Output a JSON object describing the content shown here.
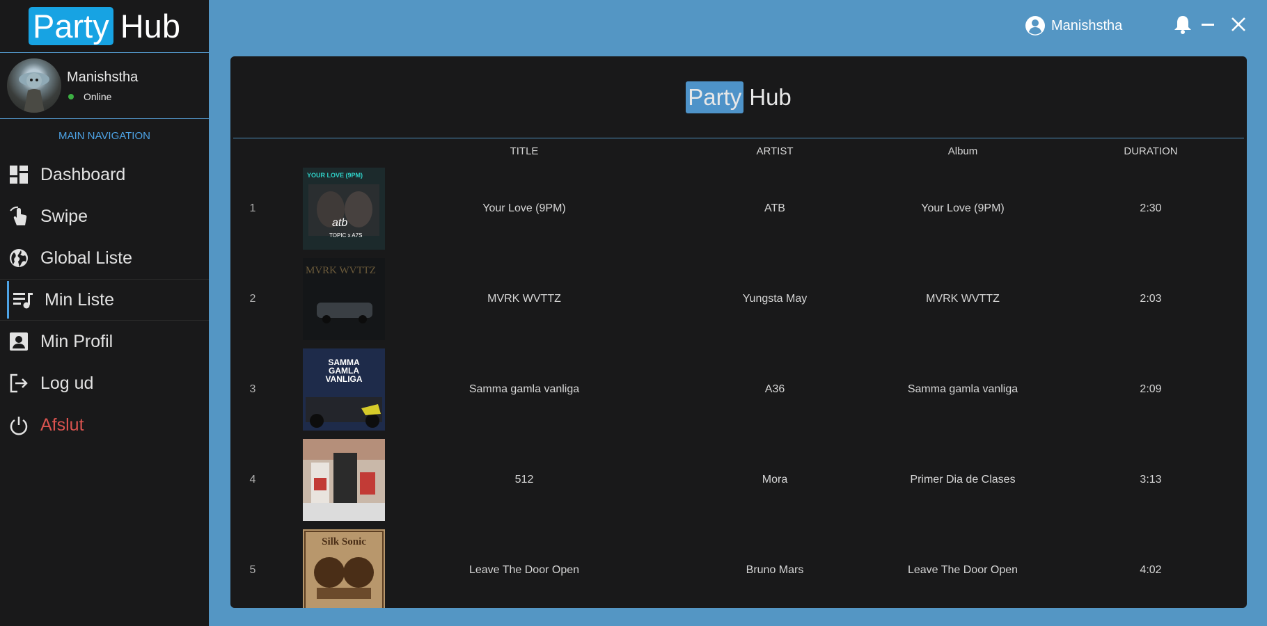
{
  "app": {
    "logo_party": "Party",
    "logo_hub": "Hub"
  },
  "sidebar": {
    "user": {
      "name": "Manishstha",
      "status": "Online"
    },
    "nav_header": "MAIN NAVIGATION",
    "items": [
      {
        "label": "Dashboard",
        "icon": "dashboard-icon",
        "active": false
      },
      {
        "label": "Swipe",
        "icon": "swipe-icon",
        "active": false
      },
      {
        "label": "Global Liste",
        "icon": "globe-icon",
        "active": false
      },
      {
        "label": "Min Liste",
        "icon": "playlist-icon",
        "active": true
      },
      {
        "label": "Min Profil",
        "icon": "profile-icon",
        "active": false
      },
      {
        "label": "Log ud",
        "icon": "logout-icon",
        "active": false
      },
      {
        "label": "Afslut",
        "icon": "power-icon",
        "active": false
      }
    ]
  },
  "topbar": {
    "username": "Manishstha"
  },
  "main": {
    "logo_party": "Party",
    "logo_hub": "Hub",
    "columns": [
      "TITLE",
      "ARTIST",
      "Album",
      "DURATION"
    ],
    "rows": [
      {
        "num": "1",
        "title": "Your Love (9PM)",
        "artist": "ATB",
        "album": "Your Love (9PM)",
        "duration": "2:30"
      },
      {
        "num": "2",
        "title": "MVRK WVTTZ",
        "artist": "Yungsta May",
        "album": "MVRK WVTTZ",
        "duration": "2:03"
      },
      {
        "num": "3",
        "title": "Samma gamla vanliga",
        "artist": "A36",
        "album": "Samma gamla vanliga",
        "duration": "2:09"
      },
      {
        "num": "4",
        "title": "512",
        "artist": "Mora",
        "album": "Primer Dia de Clases",
        "duration": "3:13"
      },
      {
        "num": "5",
        "title": "Leave The Door Open",
        "artist": "Bruno Mars",
        "album": "Leave The Door Open",
        "duration": "4:02"
      }
    ],
    "covers": {
      "1": {
        "lines": [
          "YOUR LOVE (9PM)",
          "atb",
          "TOPIC x A7S"
        ]
      },
      "2": {
        "lines": [
          "MVRK WVTTZ"
        ]
      },
      "3": {
        "lines": [
          "SAMMA",
          "GAMLA",
          "VANLIGA"
        ]
      },
      "4": {
        "lines": []
      },
      "5": {
        "lines": [
          "Silk Sonic"
        ]
      }
    }
  },
  "colors": {
    "background": "#5496c4",
    "sidebar": "#19191a",
    "accent": "#4da3e6",
    "logo_party_bg": "#17a3e3",
    "exit_red": "#d9534f"
  }
}
